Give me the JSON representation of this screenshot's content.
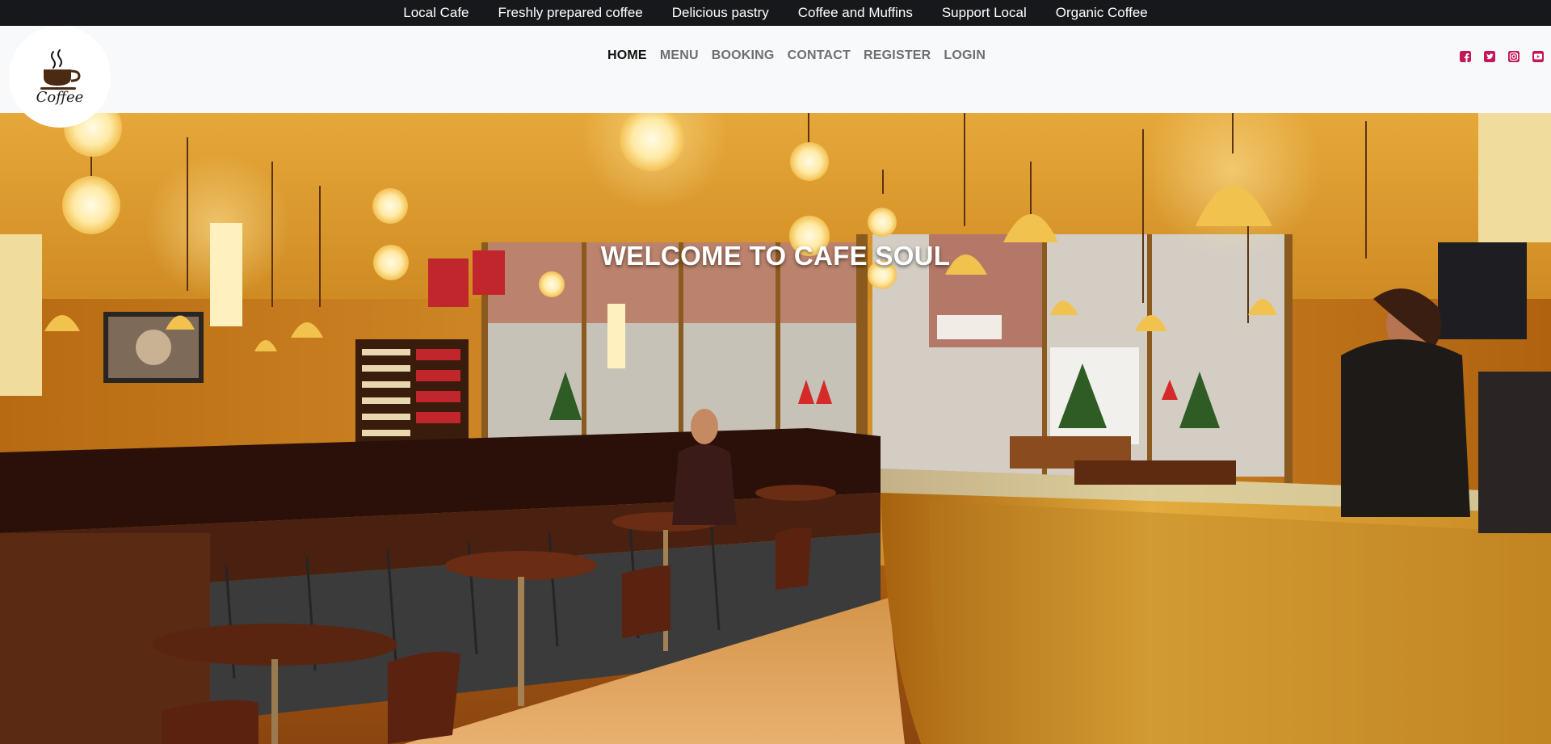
{
  "topbar": {
    "items": [
      "Local Cafe",
      "Freshly prepared coffee",
      "Delicious pastry",
      "Coffee and Muffins",
      "Support Local",
      "Organic Coffee"
    ]
  },
  "logo": {
    "text": "Coffee",
    "icon": "coffee-cup-icon"
  },
  "nav": {
    "items": [
      "HOME",
      "MENU",
      "BOOKING",
      "CONTACT",
      "REGISTER",
      "LOGIN"
    ],
    "active": "HOME"
  },
  "social": {
    "icons": [
      "facebook-icon",
      "twitter-icon",
      "instagram-icon",
      "youtube-icon"
    ],
    "color": "#c2185b"
  },
  "hero": {
    "title": "WELCOME TO CAFE SOUL"
  },
  "colors": {
    "topbar_bg": "#16181b",
    "header_bg": "#f8f9fa",
    "nav_active": "#111111",
    "nav_inactive": "#6c6f73"
  }
}
